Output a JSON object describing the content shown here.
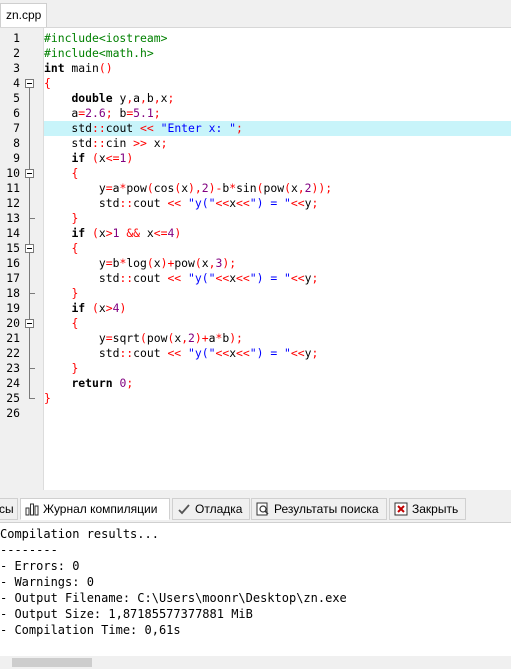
{
  "file_tab": "zn.cpp",
  "code_lines": [
    [
      [
        "pp",
        "#include<iostream>"
      ]
    ],
    [
      [
        "pp",
        "#include<math.h>"
      ]
    ],
    [
      [
        "kw",
        "int"
      ],
      [
        "t",
        " main"
      ],
      [
        "sym",
        "()"
      ]
    ],
    [
      [
        "sym",
        "{"
      ]
    ],
    [
      [
        "t",
        "    "
      ],
      [
        "kw",
        "double"
      ],
      [
        "t",
        " y"
      ],
      [
        "sym",
        ","
      ],
      [
        "t",
        "a"
      ],
      [
        "sym",
        ","
      ],
      [
        "t",
        "b"
      ],
      [
        "sym",
        ","
      ],
      [
        "t",
        "x"
      ],
      [
        "sym",
        ";"
      ]
    ],
    [
      [
        "t",
        "    a"
      ],
      [
        "sym",
        "="
      ],
      [
        "num",
        "2.6"
      ],
      [
        "sym",
        ";"
      ],
      [
        "t",
        " b"
      ],
      [
        "sym",
        "="
      ],
      [
        "num",
        "5.1"
      ],
      [
        "sym",
        ";"
      ]
    ],
    [
      [
        "t",
        "    std"
      ],
      [
        "sym",
        "::"
      ],
      [
        "t",
        "cout "
      ],
      [
        "sym",
        "<<"
      ],
      [
        "t",
        " "
      ],
      [
        "str",
        "\"Enter x: \""
      ],
      [
        "sym",
        ";"
      ]
    ],
    [
      [
        "t",
        "    std"
      ],
      [
        "sym",
        "::"
      ],
      [
        "t",
        "cin "
      ],
      [
        "sym",
        ">>"
      ],
      [
        "t",
        " x"
      ],
      [
        "sym",
        ";"
      ]
    ],
    [
      [
        "t",
        "    "
      ],
      [
        "kw",
        "if"
      ],
      [
        "t",
        " "
      ],
      [
        "sym",
        "("
      ],
      [
        "t",
        "x"
      ],
      [
        "sym",
        "<="
      ],
      [
        "num",
        "1"
      ],
      [
        "sym",
        ")"
      ]
    ],
    [
      [
        "t",
        "    "
      ],
      [
        "sym",
        "{"
      ]
    ],
    [
      [
        "t",
        "        y"
      ],
      [
        "sym",
        "="
      ],
      [
        "t",
        "a"
      ],
      [
        "sym",
        "*"
      ],
      [
        "t",
        "pow"
      ],
      [
        "sym",
        "("
      ],
      [
        "t",
        "cos"
      ],
      [
        "sym",
        "("
      ],
      [
        "t",
        "x"
      ],
      [
        "sym",
        "),"
      ],
      [
        "num",
        "2"
      ],
      [
        "sym",
        ")-"
      ],
      [
        "t",
        "b"
      ],
      [
        "sym",
        "*"
      ],
      [
        "t",
        "sin"
      ],
      [
        "sym",
        "("
      ],
      [
        "t",
        "pow"
      ],
      [
        "sym",
        "("
      ],
      [
        "t",
        "x"
      ],
      [
        "sym",
        ","
      ],
      [
        "num",
        "2"
      ],
      [
        "sym",
        "));"
      ]
    ],
    [
      [
        "t",
        "        std"
      ],
      [
        "sym",
        "::"
      ],
      [
        "t",
        "cout "
      ],
      [
        "sym",
        "<<"
      ],
      [
        "t",
        " "
      ],
      [
        "str",
        "\"y(\""
      ],
      [
        "sym",
        "<<"
      ],
      [
        "t",
        "x"
      ],
      [
        "sym",
        "<<"
      ],
      [
        "str",
        "\") = \""
      ],
      [
        "sym",
        "<<"
      ],
      [
        "t",
        "y"
      ],
      [
        "sym",
        ";"
      ]
    ],
    [
      [
        "t",
        "    "
      ],
      [
        "sym",
        "}"
      ]
    ],
    [
      [
        "t",
        "    "
      ],
      [
        "kw",
        "if"
      ],
      [
        "t",
        " "
      ],
      [
        "sym",
        "("
      ],
      [
        "t",
        "x"
      ],
      [
        "sym",
        ">"
      ],
      [
        "num",
        "1"
      ],
      [
        "t",
        " "
      ],
      [
        "sym",
        "&&"
      ],
      [
        "t",
        " x"
      ],
      [
        "sym",
        "<="
      ],
      [
        "num",
        "4"
      ],
      [
        "sym",
        ")"
      ]
    ],
    [
      [
        "t",
        "    "
      ],
      [
        "sym",
        "{"
      ]
    ],
    [
      [
        "t",
        "        y"
      ],
      [
        "sym",
        "="
      ],
      [
        "t",
        "b"
      ],
      [
        "sym",
        "*"
      ],
      [
        "t",
        "log"
      ],
      [
        "sym",
        "("
      ],
      [
        "t",
        "x"
      ],
      [
        "sym",
        ")+"
      ],
      [
        "t",
        "pow"
      ],
      [
        "sym",
        "("
      ],
      [
        "t",
        "x"
      ],
      [
        "sym",
        ","
      ],
      [
        "num",
        "3"
      ],
      [
        "sym",
        ");"
      ]
    ],
    [
      [
        "t",
        "        std"
      ],
      [
        "sym",
        "::"
      ],
      [
        "t",
        "cout "
      ],
      [
        "sym",
        "<<"
      ],
      [
        "t",
        " "
      ],
      [
        "str",
        "\"y(\""
      ],
      [
        "sym",
        "<<"
      ],
      [
        "t",
        "x"
      ],
      [
        "sym",
        "<<"
      ],
      [
        "str",
        "\") = \""
      ],
      [
        "sym",
        "<<"
      ],
      [
        "t",
        "y"
      ],
      [
        "sym",
        ";"
      ]
    ],
    [
      [
        "t",
        "    "
      ],
      [
        "sym",
        "}"
      ]
    ],
    [
      [
        "t",
        "    "
      ],
      [
        "kw",
        "if"
      ],
      [
        "t",
        " "
      ],
      [
        "sym",
        "("
      ],
      [
        "t",
        "x"
      ],
      [
        "sym",
        ">"
      ],
      [
        "num",
        "4"
      ],
      [
        "sym",
        ")"
      ]
    ],
    [
      [
        "t",
        "    "
      ],
      [
        "sym",
        "{"
      ]
    ],
    [
      [
        "t",
        "        y"
      ],
      [
        "sym",
        "="
      ],
      [
        "t",
        "sqrt"
      ],
      [
        "sym",
        "("
      ],
      [
        "t",
        "pow"
      ],
      [
        "sym",
        "("
      ],
      [
        "t",
        "x"
      ],
      [
        "sym",
        ","
      ],
      [
        "num",
        "2"
      ],
      [
        "sym",
        ")+"
      ],
      [
        "t",
        "a"
      ],
      [
        "sym",
        "*"
      ],
      [
        "t",
        "b"
      ],
      [
        "sym",
        ");"
      ]
    ],
    [
      [
        "t",
        "        std"
      ],
      [
        "sym",
        "::"
      ],
      [
        "t",
        "cout "
      ],
      [
        "sym",
        "<<"
      ],
      [
        "t",
        " "
      ],
      [
        "str",
        "\"y(\""
      ],
      [
        "sym",
        "<<"
      ],
      [
        "t",
        "x"
      ],
      [
        "sym",
        "<<"
      ],
      [
        "str",
        "\") = \""
      ],
      [
        "sym",
        "<<"
      ],
      [
        "t",
        "y"
      ],
      [
        "sym",
        ";"
      ]
    ],
    [
      [
        "t",
        "    "
      ],
      [
        "sym",
        "}"
      ]
    ],
    [
      [
        "t",
        "    "
      ],
      [
        "kw",
        "return"
      ],
      [
        "t",
        " "
      ],
      [
        "num",
        "0"
      ],
      [
        "sym",
        ";"
      ]
    ],
    [
      [
        "sym",
        "}"
      ]
    ],
    [
      [
        "t",
        ""
      ]
    ]
  ],
  "line_numbers": [
    "1",
    "2",
    "3",
    "4",
    "5",
    "6",
    "7",
    "8",
    "9",
    "10",
    "11",
    "12",
    "13",
    "14",
    "15",
    "16",
    "17",
    "18",
    "19",
    "20",
    "21",
    "22",
    "23",
    "24",
    "25",
    "26"
  ],
  "highlighted_line": 7,
  "fold_markers": [
    4,
    10,
    15,
    20
  ],
  "fold_ends": [
    13,
    18,
    23,
    25
  ],
  "panel_tabs": {
    "resources_cut": "сы",
    "compile_log": "Журнал компиляции",
    "debug": "Отладка",
    "search_results": "Результаты поиска",
    "close": "Закрыть"
  },
  "output_lines": [
    "Compilation results...",
    "--------",
    "- Errors: 0",
    "- Warnings: 0",
    "- Output Filename: C:\\Users\\moonr\\Desktop\\zn.exe",
    "- Output Size: 1,87185577377881 MiB",
    "- Compilation Time: 0,61s"
  ]
}
